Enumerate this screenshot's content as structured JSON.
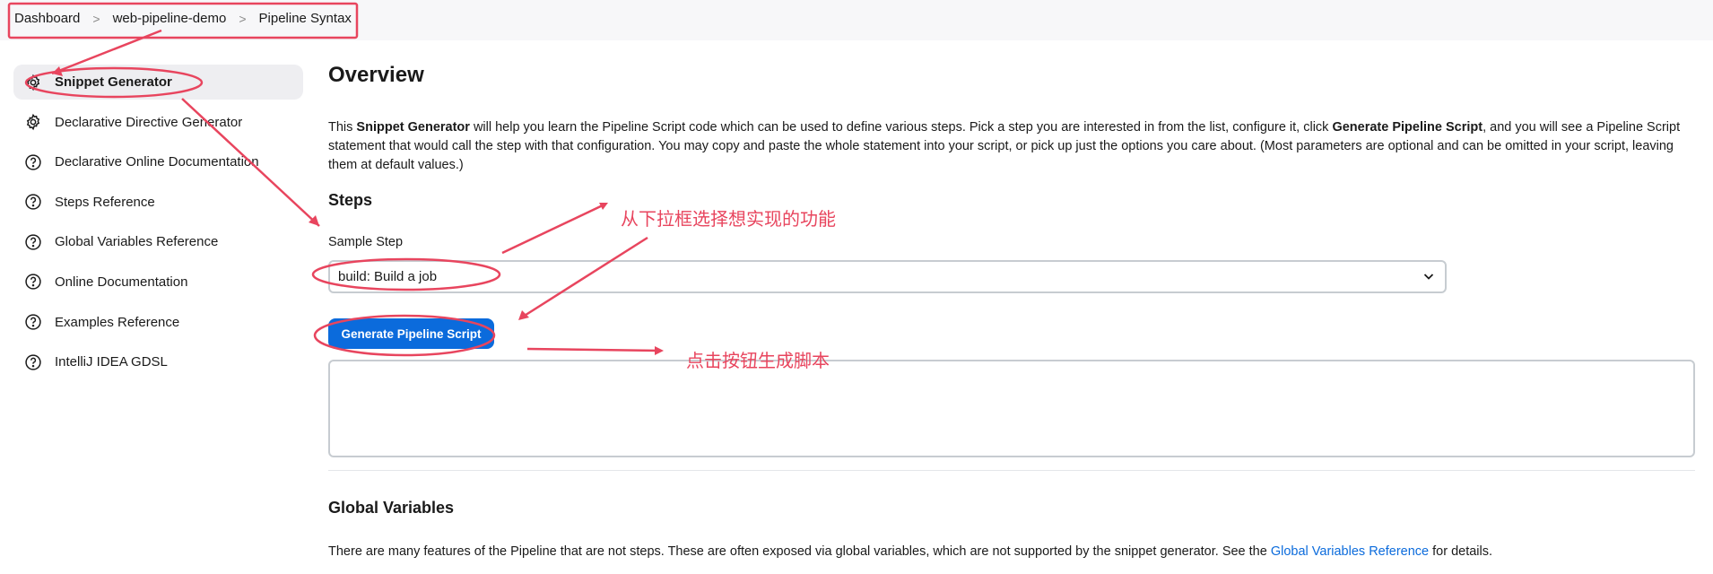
{
  "breadcrumb": {
    "items": [
      "Dashboard",
      "web-pipeline-demo",
      "Pipeline Syntax"
    ],
    "separator": ">"
  },
  "sidebar": {
    "items": [
      {
        "label": "Snippet Generator",
        "icon": "gear-icon",
        "active": true
      },
      {
        "label": "Declarative Directive Generator",
        "icon": "gear-icon",
        "active": false
      },
      {
        "label": "Declarative Online Documentation",
        "icon": "help-circle-icon",
        "active": false
      },
      {
        "label": "Steps Reference",
        "icon": "help-circle-icon",
        "active": false
      },
      {
        "label": "Global Variables Reference",
        "icon": "help-circle-icon",
        "active": false
      },
      {
        "label": "Online Documentation",
        "icon": "help-circle-icon",
        "active": false
      },
      {
        "label": "Examples Reference",
        "icon": "help-circle-icon",
        "active": false
      },
      {
        "label": "IntelliJ IDEA GDSL",
        "icon": "help-circle-icon",
        "active": false
      }
    ]
  },
  "main": {
    "title": "Overview",
    "overview": {
      "t1": "This ",
      "b1": "Snippet Generator",
      "t2": " will help you learn the Pipeline Script code which can be used to define various steps. Pick a step you are interested in from the list, configure it, click ",
      "b2": "Generate Pipeline Script",
      "t3": ", and you will see a Pipeline Script statement that would call the step with that configuration. You may copy and paste the whole statement into your script, or pick up just the options you care about. (Most parameters are optional and can be omitted in your script, leaving them at default values.)"
    },
    "steps_heading": "Steps",
    "sample_step_label": "Sample Step",
    "sample_step_value": "build: Build a job",
    "generate_button": "Generate Pipeline Script",
    "script_output": "",
    "global_variables_heading": "Global Variables",
    "global_variables_text_before": "There are many features of the Pipeline that are not steps. These are often exposed via global variables, which are not supported by the snippet generator. See the ",
    "global_variables_link": "Global Variables Reference",
    "global_variables_text_after": " for details."
  },
  "annotations": {
    "select_hint": "从下拉框选择想实现的功能",
    "button_hint": "点击按钮生成脚本",
    "color": "#e8455e"
  },
  "colors": {
    "accent": "#0b6bdc",
    "annotation": "#e8455e"
  }
}
